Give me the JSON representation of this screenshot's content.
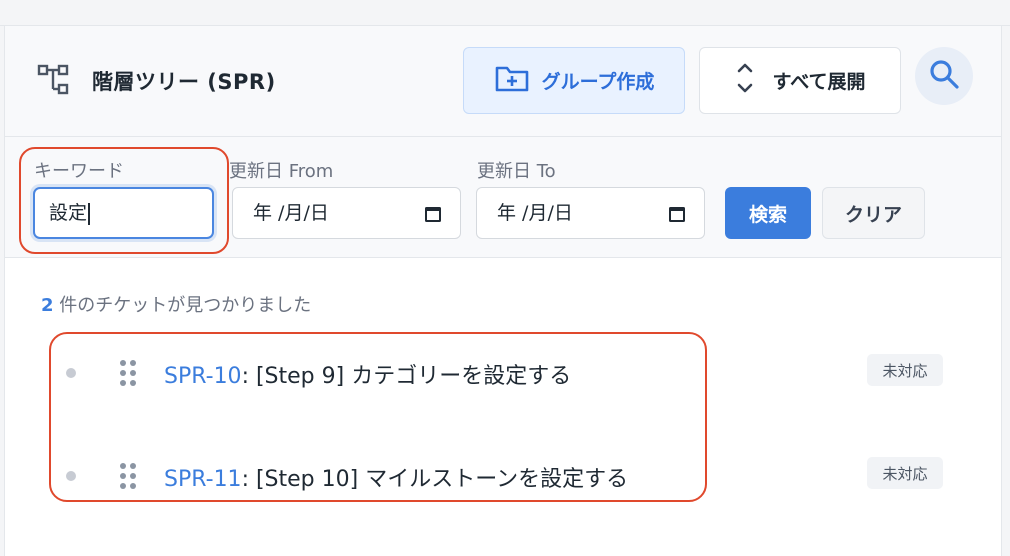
{
  "header": {
    "title": "階層ツリー (SPR)",
    "tree_icon": "hierarchy-tree-icon",
    "create_group_label": "グループ作成",
    "create_group_icon": "folder-plus-icon",
    "expand_all_label": "すべて展開",
    "expand_icon": "chevrons-up-down-icon",
    "search_icon": "search-icon"
  },
  "filters": {
    "keyword_label": "キーワード",
    "keyword_value": "設定",
    "updated_from_label": "更新日 From",
    "updated_from_value": "年 /月/日",
    "updated_to_label": "更新日 To",
    "updated_to_value": "年 /月/日",
    "calendar_icon": "calendar-icon",
    "search_label": "検索",
    "clear_label": "クリア"
  },
  "results": {
    "count": "2",
    "count_suffix": " 件のチケットが見つかりました",
    "items": [
      {
        "key": "SPR-10",
        "title": ": [Step 9] カテゴリーを設定する",
        "status": "未対応"
      },
      {
        "key": "SPR-11",
        "title": ": [Step 10] マイルストーンを設定する",
        "status": "未対応"
      }
    ]
  },
  "colors": {
    "accent": "#3b7ddd",
    "highlight": "#e0492d"
  }
}
